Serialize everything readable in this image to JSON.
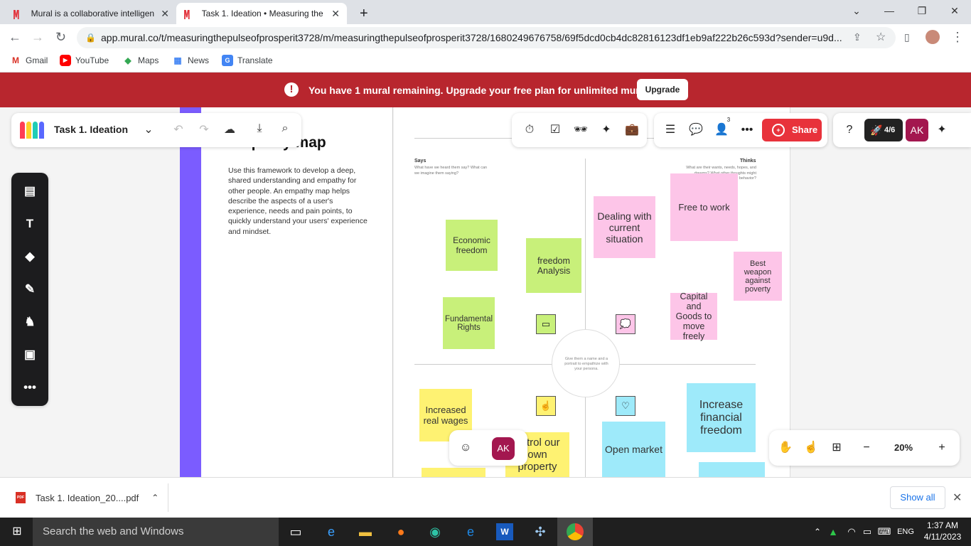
{
  "browser": {
    "tabs": [
      {
        "title": "Mural is a collaborative intelligen",
        "active": false
      },
      {
        "title": "Task 1. Ideation • Measuring the",
        "active": true
      }
    ],
    "url": "app.mural.co/t/measuringthepulseofprosperit3728/m/measuringthepulseofprosperit3728/1680249676758/69f5dcd0cb4dc82816123df1eb9af222b26c593d?sender=u9d...",
    "bookmarks": [
      "Gmail",
      "YouTube",
      "Maps",
      "News",
      "Translate"
    ]
  },
  "banner": {
    "message": "You have 1 mural remaining. Upgrade your free plan for unlimited murals.",
    "button": "Upgrade",
    "color": "#b8262e"
  },
  "header": {
    "mural_title": "Task 1. Ideation",
    "share_label": "Share",
    "progress": "4/6",
    "avatar": "AK",
    "participants_count": "3"
  },
  "template": {
    "title": "Empathy map",
    "description": "Use this framework to develop a deep, shared understanding and empathy for other people. An empathy map helps describe the aspects of a user's experience, needs and pain points, to quickly understand your users' experience and mindset."
  },
  "board": {
    "says_title": "Says",
    "says_sub": "What have we heard them say? What can we imagine them saying?",
    "thinks_title": "Thinks",
    "thinks_sub": "What are their wants, needs, hopes, and dreams? What other thoughts might influence their behavior?",
    "persona_text": "Give them a name and a portrait to empathize with your persona.",
    "stickies": {
      "economic_freedom": "Economic freedom",
      "freedom_analysis": "freedom Analysis",
      "fundamental_rights": "Fundamental Rights",
      "dealing_current": "Dealing with current situation",
      "free_to_work": "Free to work",
      "best_weapon": "Best weapon against poverty",
      "capital_goods": "Capital and Goods to move freely",
      "increased_wages": "Increased real wages",
      "control_property": "ontrol our own property",
      "open_market": "Open market",
      "financial_freedom": "Increase financial freedom"
    }
  },
  "zoom": {
    "value": "20%"
  },
  "download": {
    "file": "Task 1. Ideation_20....pdf",
    "show_all": "Show all"
  },
  "taskbar": {
    "search_placeholder": "Search the web and Windows",
    "lang": "ENG",
    "time": "1:37 AM",
    "date": "4/11/2023"
  }
}
